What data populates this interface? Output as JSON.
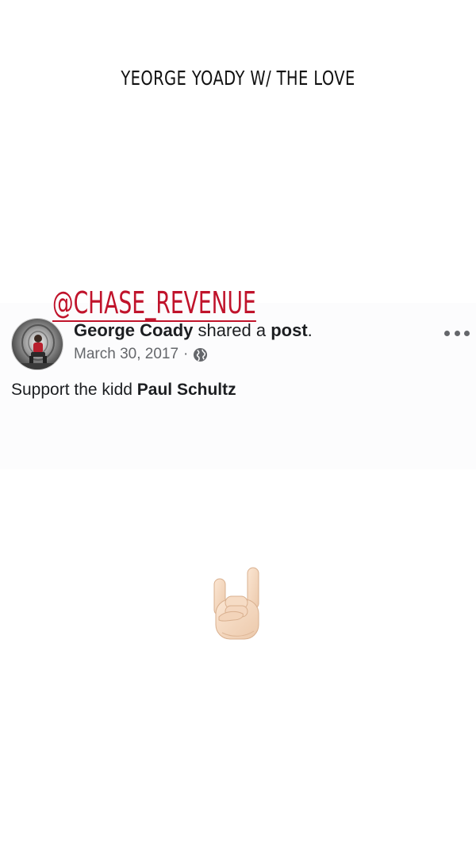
{
  "story": {
    "caption": "YEORGE YOADY W/ THE LOVE",
    "mention": "@CHASE_REVENUE",
    "sticker_icon": "rock-on-hand-icon"
  },
  "post": {
    "author": "George Coady",
    "action_prefix": " shared a ",
    "action_object": "post",
    "action_suffix": ".",
    "date": "March 30, 2017",
    "separator": "·",
    "privacy_icon": "globe-icon",
    "more_icon": "more-options-icon",
    "text_prefix": "Support the kidd ",
    "text_tagged": "Paul Schultz"
  },
  "colors": {
    "mention": "#c0132b",
    "meta_text": "#65676b",
    "body_text": "#1c1e21"
  }
}
